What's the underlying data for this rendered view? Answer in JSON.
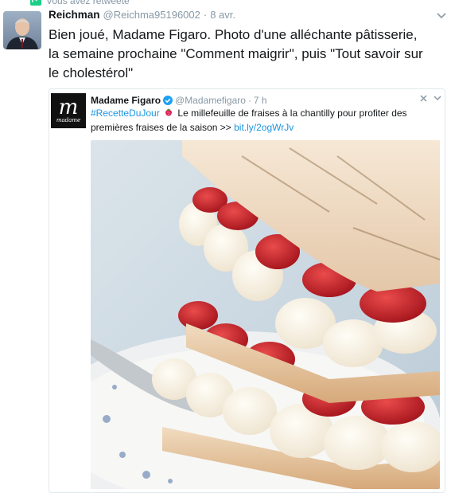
{
  "retweet_banner": {
    "text": "Vous avez retweeté",
    "icon": "retweet-icon"
  },
  "tweet": {
    "author_name": "Reichman",
    "author_handle": "@Reichma95196002",
    "separator": "·",
    "date": "8 avr.",
    "text": "Bien joué, Madame Figaro. Photo d'une alléchante pâtisserie,\nla semaine prochaine \"Comment maigrir\",  puis \"Tout savoir sur\nle cholestérol\""
  },
  "quoted_tweet": {
    "logo_letter": "m",
    "logo_subtext": "madame",
    "author_name": "Madame Figaro",
    "author_handle": "@Madamefigaro",
    "separator": "·",
    "time": "7 h",
    "hashtag": "#RecetteDuJour",
    "text_body": "Le millefeuille de fraises à la chantilly pour profiter des premières fraises de la saison >>",
    "link": "bit.ly/2ogWrJv"
  },
  "colors": {
    "link": "#1b95e0",
    "muted": "#8899a6",
    "text": "#14171a",
    "retweet_green": "#19cf86",
    "verified_blue": "#1da1f2"
  }
}
